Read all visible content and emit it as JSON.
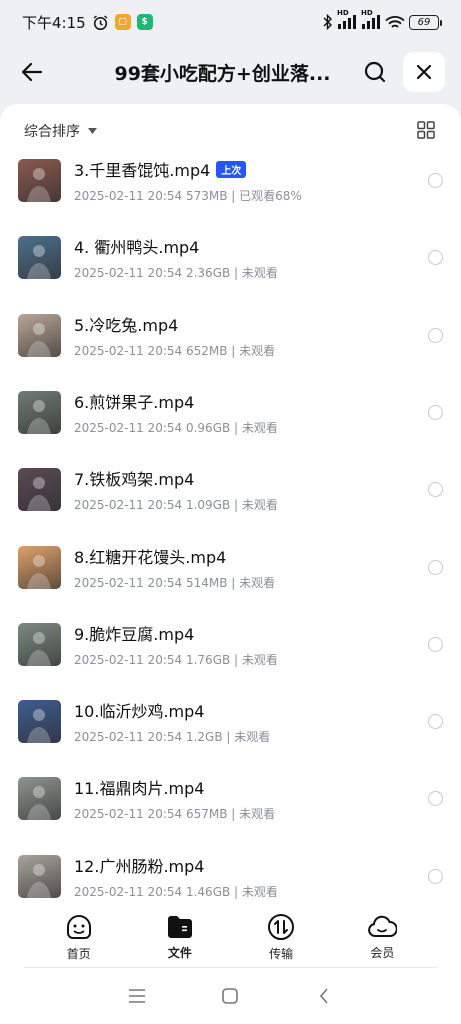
{
  "status_bar": {
    "time": "下午4:15",
    "battery": "69",
    "hd1": "HD",
    "hd2": "HD"
  },
  "header": {
    "title": "99套小吃配方+创业落..."
  },
  "toolbar": {
    "sort_label": "综合排序"
  },
  "files": [
    {
      "name": "3.千里香馄饨.mp4",
      "date": "2025-02-11 20:54",
      "size": "573MB",
      "status": "已观看68%",
      "tag": "上次",
      "thumb_color": "#8a5a4e"
    },
    {
      "name": "4. 衢州鸭头.mp4",
      "date": "2025-02-11 20:54",
      "size": "2.36GB",
      "status": "未观看",
      "tag": "",
      "thumb_color": "#4d6f8c"
    },
    {
      "name": "5.冷吃兔.mp4",
      "date": "2025-02-11 20:54",
      "size": "652MB",
      "status": "未观看",
      "tag": "",
      "thumb_color": "#b8a696"
    },
    {
      "name": "6.煎饼果子.mp4",
      "date": "2025-02-11 20:54",
      "size": "0.96GB",
      "status": "未观看",
      "tag": "",
      "thumb_color": "#6e7c74"
    },
    {
      "name": "7.铁板鸡架.mp4",
      "date": "2025-02-11 20:54",
      "size": "1.09GB",
      "status": "未观看",
      "tag": "",
      "thumb_color": "#5a4a55"
    },
    {
      "name": "8.红糖开花馒头.mp4",
      "date": "2025-02-11 20:54",
      "size": "514MB",
      "status": "未观看",
      "tag": "",
      "thumb_color": "#e0a06a"
    },
    {
      "name": "9.脆炸豆腐.mp4",
      "date": "2025-02-11 20:54",
      "size": "1.76GB",
      "status": "未观看",
      "tag": "",
      "thumb_color": "#7d8a80"
    },
    {
      "name": "10.临沂炒鸡.mp4",
      "date": "2025-02-11 20:54",
      "size": "1.2GB",
      "status": "未观看",
      "tag": "",
      "thumb_color": "#3f5c8f"
    },
    {
      "name": "11.福鼎肉片.mp4",
      "date": "2025-02-11 20:54",
      "size": "657MB",
      "status": "未观看",
      "tag": "",
      "thumb_color": "#8e9590"
    },
    {
      "name": "12.广州肠粉.mp4",
      "date": "2025-02-11 20:54",
      "size": "1.46GB",
      "status": "未观看",
      "tag": "",
      "thumb_color": "#a9a49c"
    }
  ],
  "bottom_nav": {
    "home": "首页",
    "files": "文件",
    "transfer": "传输",
    "member": "会员"
  },
  "colors": {
    "accent": "#2457f5",
    "meta_text": "#8a8f99"
  }
}
